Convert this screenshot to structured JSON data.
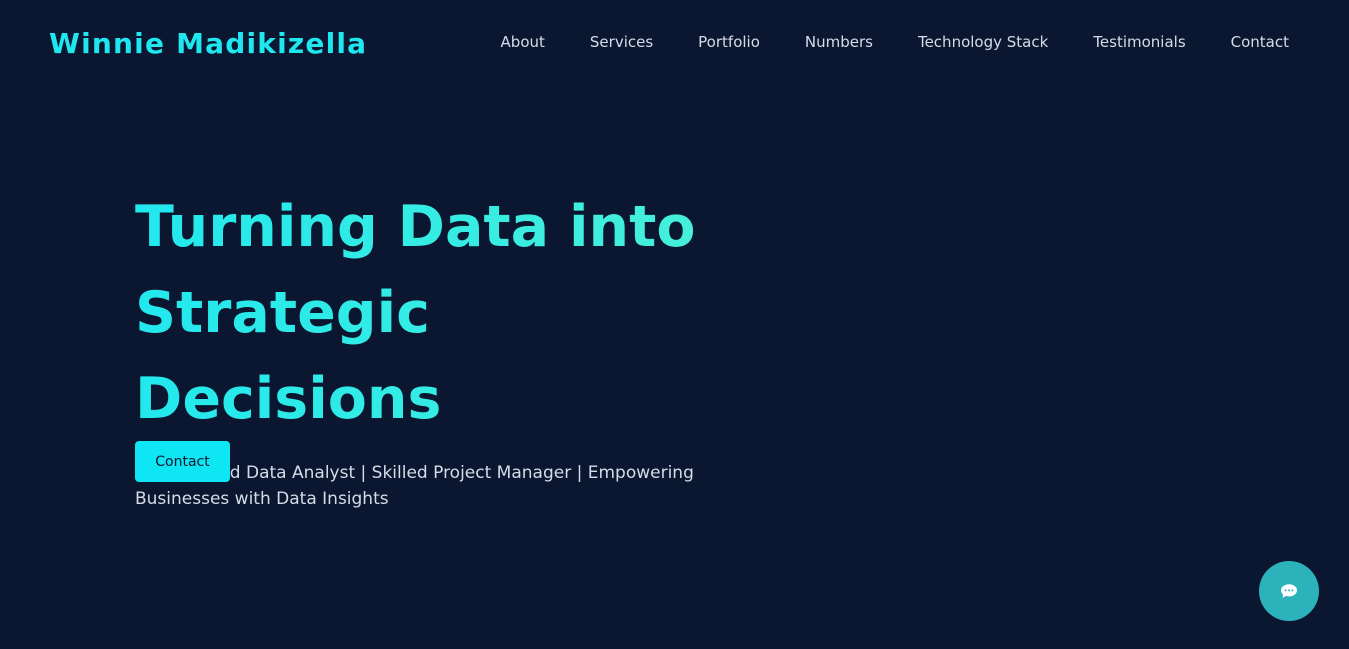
{
  "header": {
    "brand": "Winnie Madikizella",
    "nav": [
      {
        "label": "About"
      },
      {
        "label": "Services"
      },
      {
        "label": "Portfolio"
      },
      {
        "label": "Numbers"
      },
      {
        "label": "Technology Stack"
      },
      {
        "label": "Testimonials"
      },
      {
        "label": "Contact"
      }
    ]
  },
  "hero": {
    "title": "Turning Data into Strategic Decisions",
    "subtitle": "Experienced Data Analyst | Skilled Project Manager | Empowering Businesses with Data Insights",
    "cta_label": "Contact"
  },
  "chat": {
    "icon": "chat-bubble-icon"
  },
  "colors": {
    "background": "#0b1730",
    "accent": "#0fe6f3",
    "title_gradient_start": "#22e8ee",
    "title_gradient_end": "#49f0d8",
    "nav_text": "#d7dbe8",
    "chat_button": "#2bb2bb"
  }
}
